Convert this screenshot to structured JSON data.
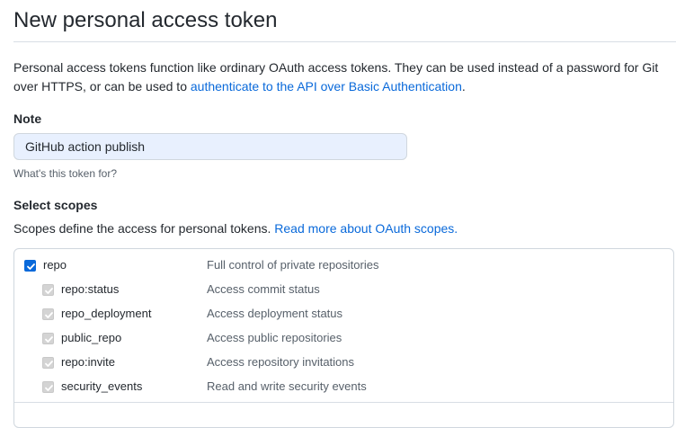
{
  "page": {
    "title": "New personal access token",
    "intro_text": "Personal access tokens function like ordinary OAuth access tokens. They can be used instead of a password for Git over HTTPS, or can be used to ",
    "intro_link": "authenticate to the API over Basic Authentication",
    "intro_end": "."
  },
  "note": {
    "label": "Note",
    "value": "GitHub action publish",
    "hint": "What's this token for?"
  },
  "scopes": {
    "label": "Select scopes",
    "description": "Scopes define the access for personal tokens. ",
    "link": "Read more about OAuth scopes.",
    "items": [
      {
        "name": "repo",
        "description": "Full control of private repositories",
        "checked": true,
        "disabled": false
      },
      {
        "name": "repo:status",
        "description": "Access commit status",
        "checked": true,
        "disabled": true
      },
      {
        "name": "repo_deployment",
        "description": "Access deployment status",
        "checked": true,
        "disabled": true
      },
      {
        "name": "public_repo",
        "description": "Access public repositories",
        "checked": true,
        "disabled": true
      },
      {
        "name": "repo:invite",
        "description": "Access repository invitations",
        "checked": true,
        "disabled": true
      },
      {
        "name": "security_events",
        "description": "Read and write security events",
        "checked": true,
        "disabled": true
      }
    ]
  },
  "colors": {
    "accent": "#0969da",
    "input_autofill_bg": "#e8f0fe",
    "muted_text": "#57606a",
    "border": "#d0d7de"
  }
}
